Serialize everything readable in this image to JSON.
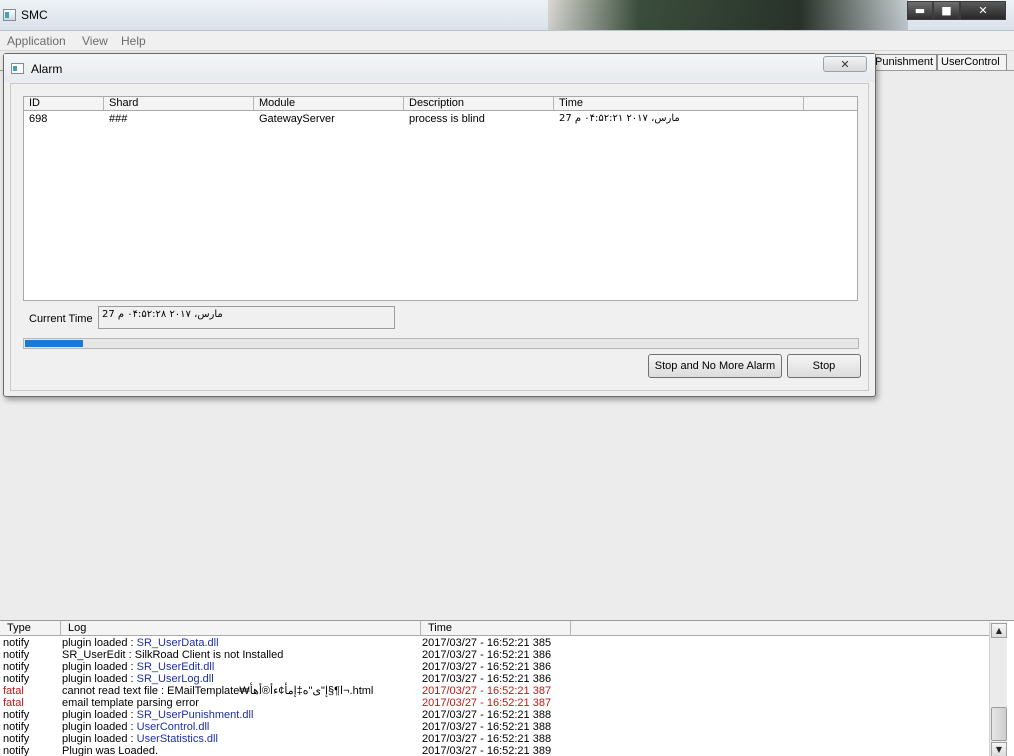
{
  "app": {
    "title": "SMC"
  },
  "window_controls": {
    "minimize": "▬",
    "maximize": "■",
    "close": "✕"
  },
  "menu": {
    "items": [
      "Application",
      "View",
      "Help"
    ]
  },
  "tabs": [
    "Punishment",
    "UserControl"
  ],
  "alarm": {
    "title": "Alarm",
    "close_glyph": "✕",
    "columns": [
      "ID",
      "Shard",
      "Module",
      "Description",
      "Time"
    ],
    "rows": [
      {
        "id": "698",
        "shard": "###",
        "module": "GatewayServer",
        "description": "process is blind",
        "time": "27 مارس، ۲۰۱۷ ۰۴:۵۲:۲۱ م"
      }
    ],
    "current_time_label": "Current Time",
    "current_time_value": "27 مارس، ۲۰۱۷ ۰۴:۵۲:۲۸ م",
    "progress": 0.07,
    "stop_no_more_label": "Stop and No More Alarm",
    "stop_label": "Stop"
  },
  "log": {
    "columns": [
      "Type",
      "Log",
      "Time"
    ],
    "rows": [
      {
        "type": "notify",
        "prefix": "plugin loaded : ",
        "link": "SR_UserData.dll",
        "time": "2017/03/27 - 16:52:21 385",
        "level": "notify"
      },
      {
        "type": "notify",
        "prefix": "SR_UserEdit : SilkRoad Client is not Installed",
        "link": "",
        "time": "2017/03/27 - 16:52:21 386",
        "level": "notify"
      },
      {
        "type": "notify",
        "prefix": "plugin loaded : ",
        "link": "SR_UserEdit.dll",
        "time": "2017/03/27 - 16:52:21 386",
        "level": "notify"
      },
      {
        "type": "notify",
        "prefix": "plugin loaded : ",
        "link": "SR_UserLog.dll",
        "time": "2017/03/27 - 16:52:21 386",
        "level": "notify"
      },
      {
        "type": "fatal",
        "prefix": "cannot read text file : EMailTemplate₩ا¶§إ\"ى\"ه‡إمأ¢ءأ®أھأ¬.html",
        "link": "",
        "time": "2017/03/27 - 16:52:21 387",
        "level": "fatal"
      },
      {
        "type": "fatal",
        "prefix": "email template parsing error",
        "link": "",
        "time": "2017/03/27 - 16:52:21 387",
        "level": "fatal"
      },
      {
        "type": "notify",
        "prefix": "plugin loaded : ",
        "link": "SR_UserPunishment.dll",
        "time": "2017/03/27 - 16:52:21 388",
        "level": "notify"
      },
      {
        "type": "notify",
        "prefix": "plugin loaded : ",
        "link": "UserControl.dll",
        "time": "2017/03/27 - 16:52:21 388",
        "level": "notify"
      },
      {
        "type": "notify",
        "prefix": "plugin loaded : ",
        "link": "UserStatistics.dll",
        "time": "2017/03/27 - 16:52:21 388",
        "level": "notify"
      },
      {
        "type": "notify",
        "prefix": "Plugin was Loaded.",
        "link": "",
        "time": "2017/03/27 - 16:52:21 389",
        "level": "notify"
      }
    ]
  },
  "colors": {
    "link": "#1c2fa8",
    "fatal": "#c01818",
    "progress": "#1c78d6"
  }
}
